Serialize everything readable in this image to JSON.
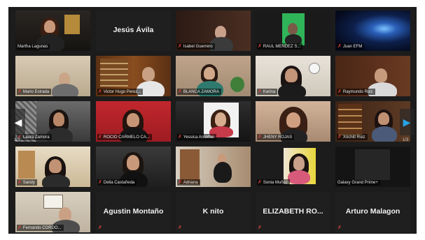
{
  "participants": [
    {
      "name": "Martha Lagunas"
    },
    {
      "name": "Jesús Ávila"
    },
    {
      "name": "Isabel Guerrero"
    },
    {
      "name": "RAUL MENDEZ S..."
    },
    {
      "name": "Juan EFM"
    },
    {
      "name": "Mario Estrada"
    },
    {
      "name": "Victor Hugo Perez..."
    },
    {
      "name": "BLANCA ZAMORA"
    },
    {
      "name": "Karina"
    },
    {
      "name": "Raymundo Ruiz"
    },
    {
      "name": "Laura Zamora"
    },
    {
      "name": "ROCIO CARMELO CA..."
    },
    {
      "name": "Yessica Arcadas"
    },
    {
      "name": "JHENY ROJAS"
    },
    {
      "name": "Xóchitl Ruiz"
    },
    {
      "name": "Sandy"
    },
    {
      "name": "Delia Castañeda"
    },
    {
      "name": "Adriana"
    },
    {
      "name": "Sonia Muñoz"
    },
    {
      "name": "Galaxy Grand Prime+"
    },
    {
      "name": "Fernando CORDO..."
    },
    {
      "name": "Agustin Montaño"
    },
    {
      "name": "K nito"
    },
    {
      "name": "ELIZABETH RO..."
    },
    {
      "name": "Arturo Malagon"
    }
  ],
  "pagination": {
    "left_page": "1/3",
    "right_page": "1/3"
  },
  "icons": {
    "mute": "muted-microphone-icon",
    "prev": "chevron-left-icon",
    "next": "chevron-right-icon"
  },
  "colors": {
    "active_speaker_border": "#d7d31f",
    "mute": "#e0423a",
    "next_arrow": "#27a4e6"
  }
}
